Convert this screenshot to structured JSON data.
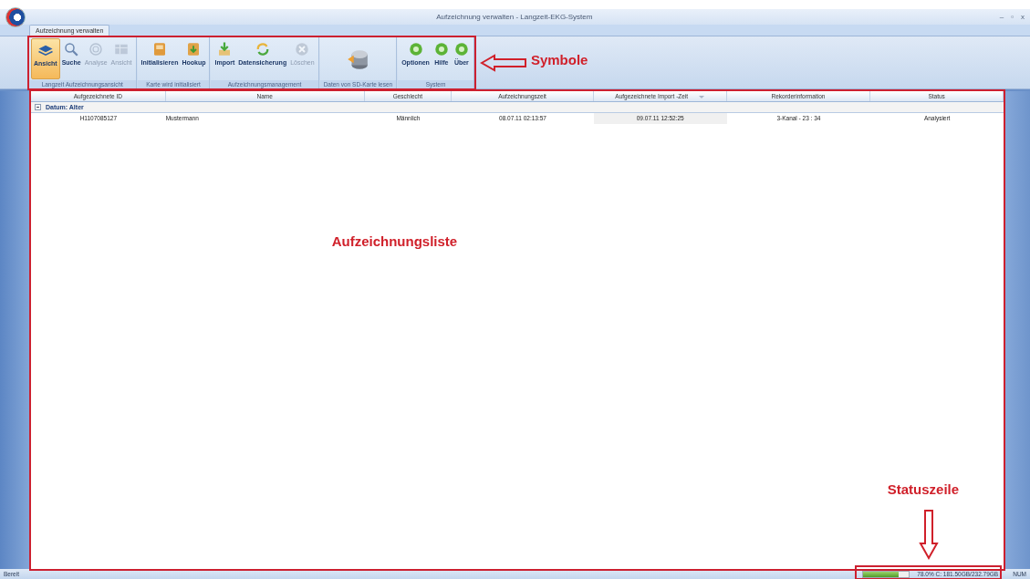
{
  "window": {
    "title": "Aufzeichnung verwalten  -  Langzeit-EKG-System",
    "controls": [
      "–",
      "▫",
      "x"
    ]
  },
  "tabs": [
    {
      "label": "Aufzeichnung verwalten",
      "selected": true
    }
  ],
  "ribbon": {
    "groups": [
      {
        "label": "Langzeit Aufzeichnungsansicht",
        "buttons": [
          {
            "label": "Ansicht",
            "selected": true,
            "disabled": false
          },
          {
            "label": "Suche",
            "selected": false,
            "disabled": false
          },
          {
            "label": "Analyse",
            "selected": false,
            "disabled": true
          },
          {
            "label": "Ansicht",
            "selected": false,
            "disabled": true
          }
        ]
      },
      {
        "label": "Karte wird initialisiert",
        "buttons": [
          {
            "label": "Initialisieren",
            "selected": false,
            "disabled": false
          },
          {
            "label": "Hookup",
            "selected": false,
            "disabled": false
          }
        ]
      },
      {
        "label": "Aufzeichnungsmanagement",
        "buttons": [
          {
            "label": "Import",
            "selected": false,
            "disabled": false
          },
          {
            "label": "Datensicherung",
            "selected": false,
            "disabled": false
          },
          {
            "label": "Löschen",
            "selected": false,
            "disabled": true
          }
        ]
      },
      {
        "label": "Daten von SD-Karte lesen",
        "buttons": [
          {
            "selected": false,
            "disabled": false
          }
        ]
      },
      {
        "label": "System",
        "buttons": [
          {
            "label": "Optionen",
            "selected": false,
            "disabled": false
          },
          {
            "label": "Hilfe",
            "selected": false,
            "disabled": false
          },
          {
            "label": "Über",
            "selected": false,
            "disabled": false
          }
        ]
      }
    ]
  },
  "table": {
    "columns": [
      {
        "label": "Aufgezeichnete ID",
        "sorted": false
      },
      {
        "label": "Name",
        "sorted": false
      },
      {
        "label": "Geschlecht",
        "sorted": false
      },
      {
        "label": "Aufzeichnungszeit",
        "sorted": false
      },
      {
        "label": "Aufgezeichnete Import -Zeit",
        "sorted": true
      },
      {
        "label": "Rekorderinformation",
        "sorted": false
      },
      {
        "label": "Status",
        "sorted": false
      }
    ],
    "groups": [
      {
        "label": "Datum: Alter",
        "expanded": true,
        "rows": [
          {
            "cells": [
              "H1107085127",
              "Mustermann",
              "Männlich",
              "08.07.11   02:13:57",
              "09.07.11   12:52:25",
              "3-Kanal  -  23 : 34",
              "Analysiert"
            ]
          }
        ]
      }
    ]
  },
  "status_bar": {
    "text": "Bereit",
    "disk": {
      "level": 0.78,
      "reading": "78.0%  C: 181.50GB/232.79GB"
    },
    "indicator": "NUM"
  },
  "annotations": [
    {
      "kind": "box-arrow-left",
      "label": "Symbole"
    },
    {
      "kind": "box",
      "label": "Aufzeichnungsliste"
    },
    {
      "kind": "box-arrow-down",
      "label": "Statuszeile"
    }
  ]
}
